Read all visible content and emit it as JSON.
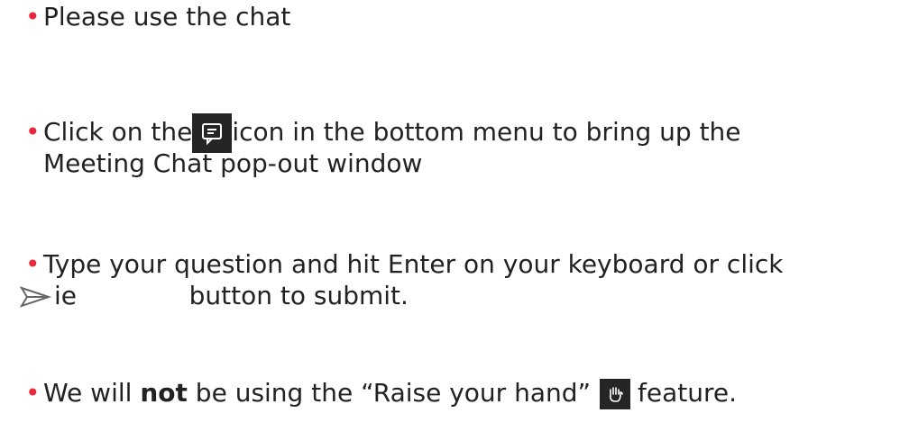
{
  "bullets": [
    {
      "text": "Please use the chat"
    },
    {
      "before": "Click on the",
      "after": "icon in the bottom menu to bring up the",
      "line2": "Meeting Chat pop-out window",
      "icon": "chat-icon"
    },
    {
      "line1": "Type your question and hit Enter on your keyboard or click",
      "fragment": "              ",
      "fragment_visible": "ie",
      "after": "button to submit.",
      "icon": "send-icon"
    },
    {
      "before": "We will",
      "bold": "not",
      "middle": "be using the “Raise your hand”",
      "after": "feature.",
      "icon": "raise-hand-icon"
    }
  ],
  "colors": {
    "bullet": "#e8283c",
    "icon_bg": "#252525",
    "text": "#222222"
  }
}
